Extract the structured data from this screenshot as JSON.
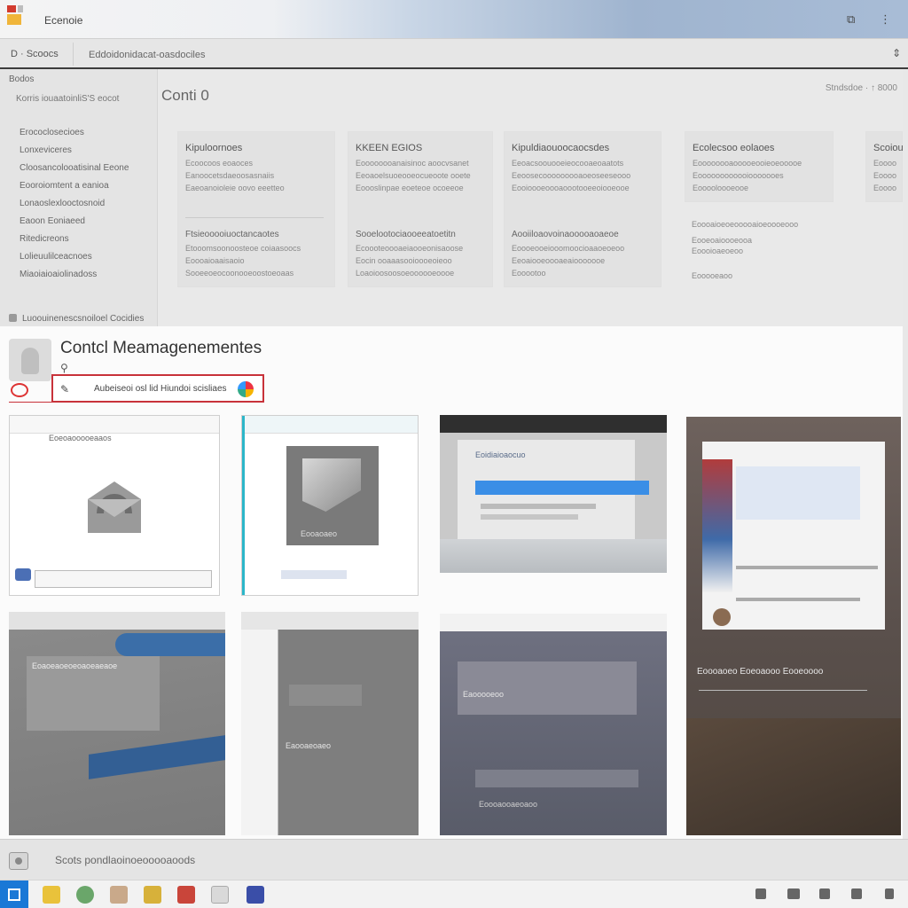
{
  "window": {
    "title": "Ecenoie",
    "restore_glyph": "⧉",
    "menu_glyph": "⋮"
  },
  "addressbar": {
    "left": "D · Scoocs",
    "path": "Eddoidonidacat-oasdociles",
    "scroll_glyph": "⇕"
  },
  "nav": {
    "header": "Bodos",
    "sub": "Korris iouaatoinliS'S eocot",
    "items": [
      "Erococlosecioes",
      "Lonxeviceres",
      "Cloosancolooatisinal Eeone",
      "Eooroiomtent a eanioa",
      "Lonaoslexlooctosnoid",
      "Eaoon Eoniaeed",
      "Ritedicreons",
      "Lolieuulilceacnoes",
      "Miaoiaioaiolinadoss"
    ],
    "footer": "Luoouinenescsnoiloel Cocidies"
  },
  "main": {
    "title": "Conti 0",
    "meta": "Stndsdoe  ·  ↑ 8000",
    "cards": [
      {
        "title": "Kipuloornoes",
        "lines": [
          "Ecoocoos eoaoces",
          "Eanoocetsdaeoosasnaiis",
          "Eaeoanoioleie oovo eeetteo"
        ],
        "title2": "Ftsieooooiuoctancaotes",
        "lines2": [
          "Etooomsoonoosteoe coiaasoocs",
          "Eoooaioaaisaoio",
          "Sooeeoeocoonooeoostoeoaas"
        ]
      },
      {
        "title": "KKEEN EGIOS",
        "lines": [
          "Eoooooooanaisinoc aoocvsanet",
          "Eeoaoelsuoeooeocueoote ooete",
          "Eoooslinpae eoeteoe ocoeeoe"
        ],
        "title2": "Sooelootociaooeeatoetitn",
        "lines2": [
          "Ecoooteoooaeiaooeonisaoose",
          "Eocin ooaaasooioooeoieoo",
          "Loaoioosoosoeoooooeoooe"
        ]
      },
      {
        "title": "Kipuldiaouoocaocsdes",
        "lines": [
          "Eeoacsoouooeieocooaeoaatots",
          "Eeoosecooooooooaoeoseeseooo",
          "Eooioooeoooaoootooeeoiooeooe"
        ],
        "title2": "Aooiiloaovoinaooooaoaeoe",
        "lines2": [
          "Eoooeooeiooomoocioaaoeoeoo",
          "Eeoaiooeoooaeaiooooooe",
          "Eooootoo"
        ]
      },
      {
        "title": "Ecolecsoo eolaoes",
        "lines": [
          "Eoooooooaooooeooieoeooooe",
          "Eoooooooooooiooooooes",
          "Eooooloooeooe"
        ],
        "title2": "",
        "lines2": []
      }
    ],
    "edge_card": {
      "title": "Scoiou",
      "lines": [
        "Eoooo",
        "Eoooo",
        "Eoooo"
      ]
    },
    "side_list": [
      "Eoooaioeoeooooaioeoooeooo",
      "Eooeoaioooeooa",
      "Eoooioaeoeoo",
      "Eooooeaoo"
    ]
  },
  "contact": {
    "title": "Contcl Meamagenementes",
    "search_text": "Aubeiseoi osl lid Hiundoi scisliaes",
    "thumbs": [
      {
        "label": "Eoeoaooooeaaos"
      },
      {
        "label": "Eooaoaeo"
      },
      {
        "label": "Eoidiaioaocuo"
      },
      {
        "label": "Eoaoeaoeoeoaoeaeaoe"
      },
      {
        "label": "Eaooaeoaeo"
      },
      {
        "label": "Eaooooeoo"
      },
      {
        "label": "Eoooaooaeoaoo"
      },
      {
        "label": "Eoooaoeo Eoeoaooo Eooeoooo"
      }
    ]
  },
  "statusbar": {
    "text": "Scots  pondlaoinoeooooaoods"
  },
  "colors": {
    "accent": "#1a78d6",
    "highlight": "#c8323a",
    "blue_strip": "#3a8ee6"
  }
}
